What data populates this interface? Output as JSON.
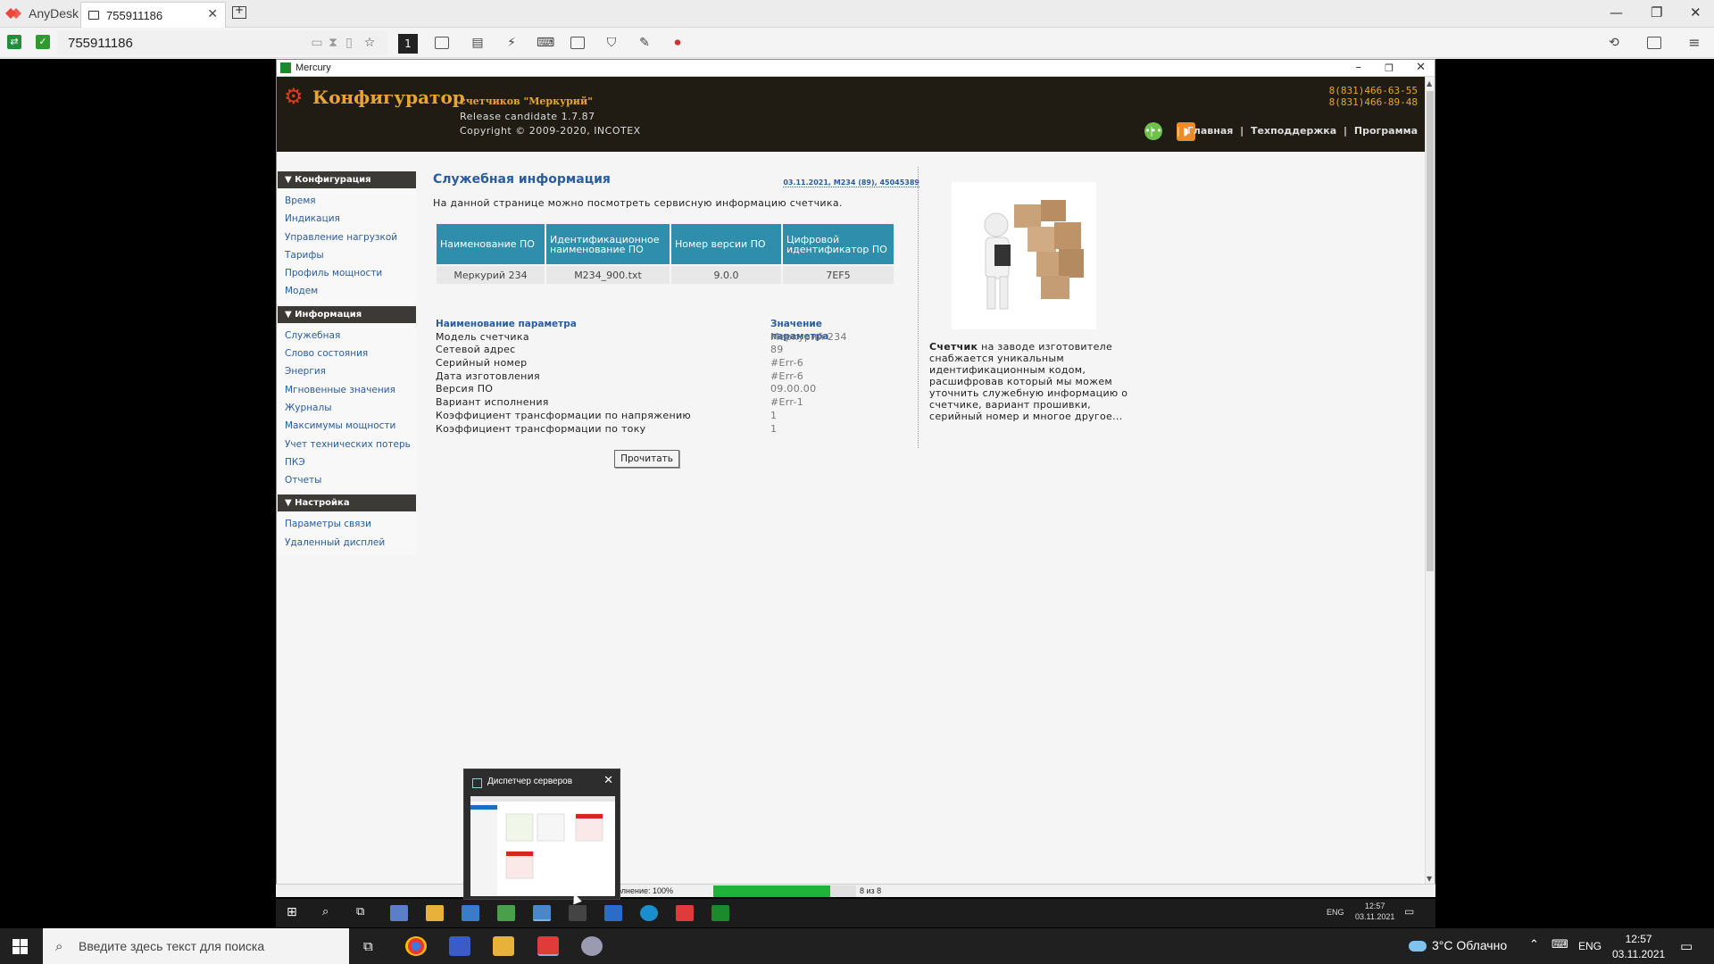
{
  "anydesk": {
    "brand": "AnyDesk",
    "tab_label": "755911186",
    "address": "755911186",
    "monitor_label": "1"
  },
  "mercury": {
    "window_title": "Mercury",
    "header": {
      "title": "Конфигуратор",
      "subtitle": "счетчиков \"Меркурий\"",
      "release": "Release candidate 1.7.87",
      "copyright": "Copyright © 2009-2020, INCOTEX",
      "phone1": "8(831)466-63-55",
      "phone2": "8(831)466-89-48",
      "nav": [
        "|",
        "|",
        "Главная",
        "|",
        "Техподдержка",
        "|",
        "Программа"
      ]
    },
    "sidebar": {
      "sections": [
        {
          "title": "▼ Конфигурация",
          "items": [
            "Время",
            "Индикация",
            "Управление нагрузкой",
            "Тарифы",
            "Профиль мощности",
            "Модем"
          ]
        },
        {
          "title": "▼ Информация",
          "items": [
            "Служебная",
            "Слово состояния",
            "Энергия",
            "Мгновенные значения",
            "Журналы",
            "Максимумы мощности",
            "Учет технических потерь",
            "ПКЭ",
            "Отчеты"
          ]
        },
        {
          "title": "▼ Настройка",
          "items": [
            "Параметры связи",
            "Удаленный дисплей"
          ]
        }
      ]
    },
    "content": {
      "page_title": "Служебная информация",
      "meta": "03.11.2021, M234 (89), 45045389",
      "intro": "На данной странице можно посмотреть сервисную информацию счетчика.",
      "sw_table": {
        "headers": [
          "Наименование ПО",
          "Идентификационное наименование ПО",
          "Номер версии ПО",
          "Цифровой идентификатор ПО"
        ],
        "row": [
          "Меркурий 234",
          "M234_900.txt",
          "9.0.0",
          "7EF5"
        ]
      },
      "params": {
        "header_name": "Наименование параметра",
        "header_value": "Значение параметра",
        "rows": [
          {
            "name": "Модель счетчика",
            "value": "Меркурий 234"
          },
          {
            "name": "Сетевой адрес",
            "value": "89"
          },
          {
            "name": "Серийный номер",
            "value": "#Err-6"
          },
          {
            "name": "Дата изготовления",
            "value": "#Err-6"
          },
          {
            "name": "Версия ПО",
            "value": "09.00.00"
          },
          {
            "name": "Вариант исполнения",
            "value": "#Err-1"
          },
          {
            "name": "Коэффициент трансформации по напряжению",
            "value": "1"
          },
          {
            "name": "Коэффициент трансформации по току",
            "value": "1"
          }
        ]
      },
      "read_button": "Прочитать"
    },
    "side_note": {
      "bold": "Счетчик",
      "text": " на заводе изготовителе снабжается уникальным идентификационным кодом, расшифровав который мы можем уточнить служебную информацию о счетчике, вариант прошивки, серийный номер и многое другое..."
    },
    "status": {
      "text": "олнение: 100%",
      "progress": 1.0,
      "count": "8 из 8"
    }
  },
  "preview": {
    "title": "Диспетчер серверов"
  },
  "remote_taskbar": {
    "lang": "ENG",
    "time": "12:57",
    "date": "03.11.2021"
  },
  "taskbar": {
    "search_placeholder": "Введите здесь текст для поиска",
    "weather": "3°C  Облачно",
    "lang": "ENG",
    "time": "12:57",
    "date": "03.11.2021"
  },
  "colors": {
    "header_bg": "#201c14",
    "accent_orange": "#e8a62e",
    "table_header": "#2e8eab",
    "link_blue": "#2a5d9a",
    "progress_green": "#1fb33b"
  }
}
